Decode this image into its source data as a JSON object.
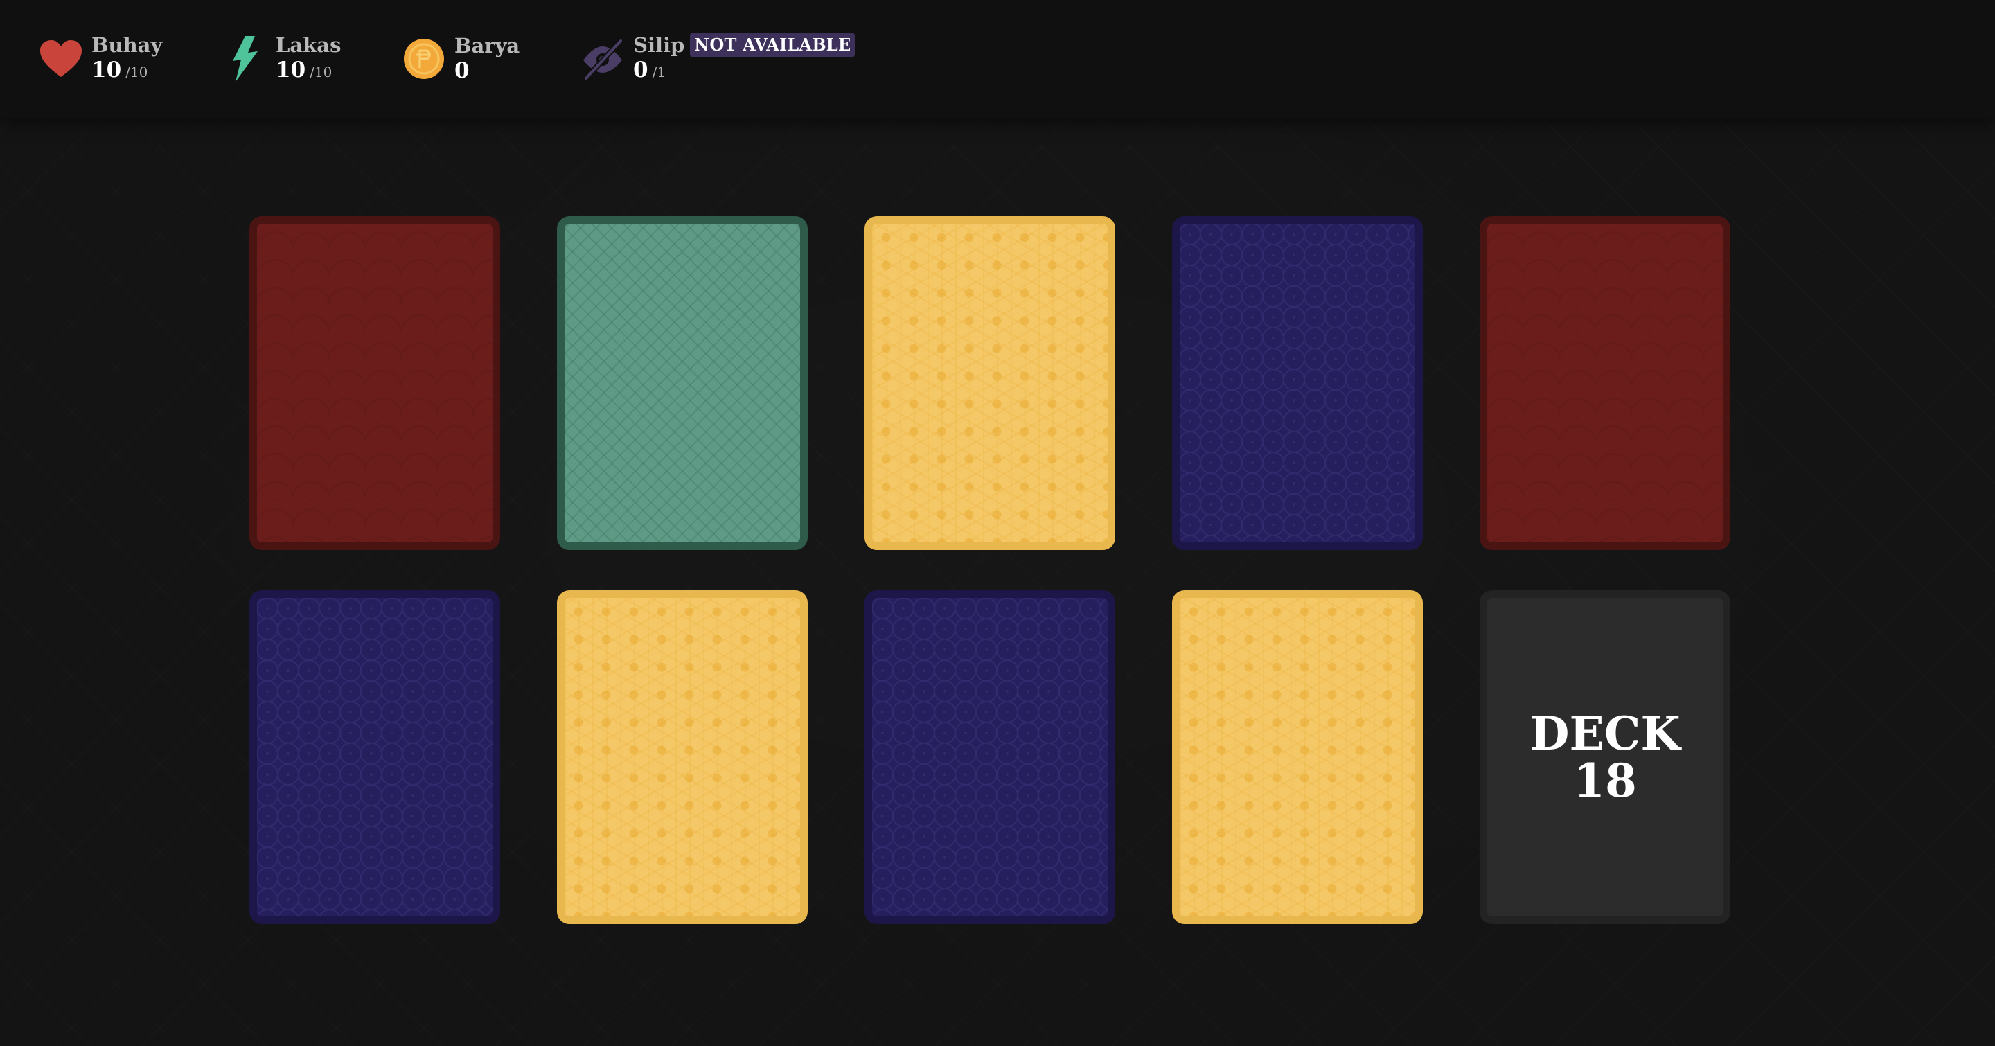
{
  "hud": {
    "health": {
      "label": "Buhay",
      "value": "10",
      "max": "/10",
      "icon": "heart-icon",
      "color": "#c9443a"
    },
    "energy": {
      "label": "Lakas",
      "value": "10",
      "max": "/10",
      "icon": "lightning-icon",
      "color": "#4fc39a"
    },
    "coins": {
      "label": "Barya",
      "value": "0",
      "icon": "coin-icon",
      "color": "#f3a93a"
    },
    "peek": {
      "label": "Silip",
      "status": "NOT AVAILABLE",
      "value": "0",
      "max": "/1",
      "icon": "eye-off-icon",
      "color": "#4a3d66"
    }
  },
  "board": {
    "cards": [
      {
        "color": "red"
      },
      {
        "color": "green"
      },
      {
        "color": "gold"
      },
      {
        "color": "blue"
      },
      {
        "color": "red"
      },
      {
        "color": "blue"
      },
      {
        "color": "gold"
      },
      {
        "color": "blue"
      },
      {
        "color": "gold"
      }
    ],
    "deck": {
      "label": "DECK",
      "count": "18"
    }
  },
  "colors": {
    "background": "#141414",
    "red": "#6b1d1b",
    "green": "#5e9a85",
    "gold": "#f4c866",
    "blue": "#251f5e",
    "deck": "#2c2c2c"
  }
}
